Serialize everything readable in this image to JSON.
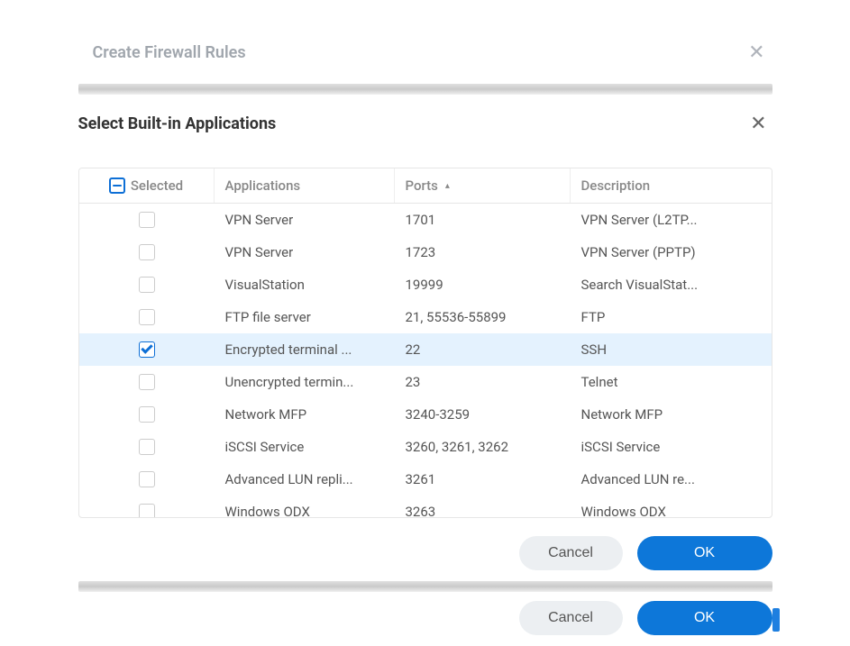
{
  "outer": {
    "title": "Create Firewall Rules",
    "close_glyph": "✕",
    "cancel_label": "Cancel",
    "ok_label": "OK"
  },
  "inner": {
    "title": "Select Built-in Applications",
    "close_glyph": "✕",
    "cancel_label": "Cancel",
    "ok_label": "OK"
  },
  "columns": {
    "selected": "Selected",
    "applications": "Applications",
    "ports": "Ports",
    "description": "Description",
    "sort_indicator": "▴"
  },
  "header_checkbox_state": "indeterminate",
  "rows": [
    {
      "checked": false,
      "selected": false,
      "app": "VPN Server",
      "ports": "1701",
      "desc": "VPN Server (L2TP..."
    },
    {
      "checked": false,
      "selected": false,
      "app": "VPN Server",
      "ports": "1723",
      "desc": "VPN Server (PPTP)"
    },
    {
      "checked": false,
      "selected": false,
      "app": "VisualStation",
      "ports": "19999",
      "desc": "Search VisualStat..."
    },
    {
      "checked": false,
      "selected": false,
      "app": "FTP file server",
      "ports": "21, 55536-55899",
      "desc": "FTP"
    },
    {
      "checked": true,
      "selected": true,
      "app": "Encrypted terminal ...",
      "ports": "22",
      "desc": "SSH"
    },
    {
      "checked": false,
      "selected": false,
      "app": "Unencrypted termin...",
      "ports": "23",
      "desc": "Telnet"
    },
    {
      "checked": false,
      "selected": false,
      "app": "Network MFP",
      "ports": "3240-3259",
      "desc": "Network MFP"
    },
    {
      "checked": false,
      "selected": false,
      "app": "iSCSI Service",
      "ports": "3260, 3261, 3262",
      "desc": "iSCSI Service"
    },
    {
      "checked": false,
      "selected": false,
      "app": "Advanced LUN repli...",
      "ports": "3261",
      "desc": "Advanced LUN re..."
    },
    {
      "checked": false,
      "selected": false,
      "app": "Windows ODX",
      "ports": "3263",
      "desc": "Windows ODX"
    }
  ]
}
